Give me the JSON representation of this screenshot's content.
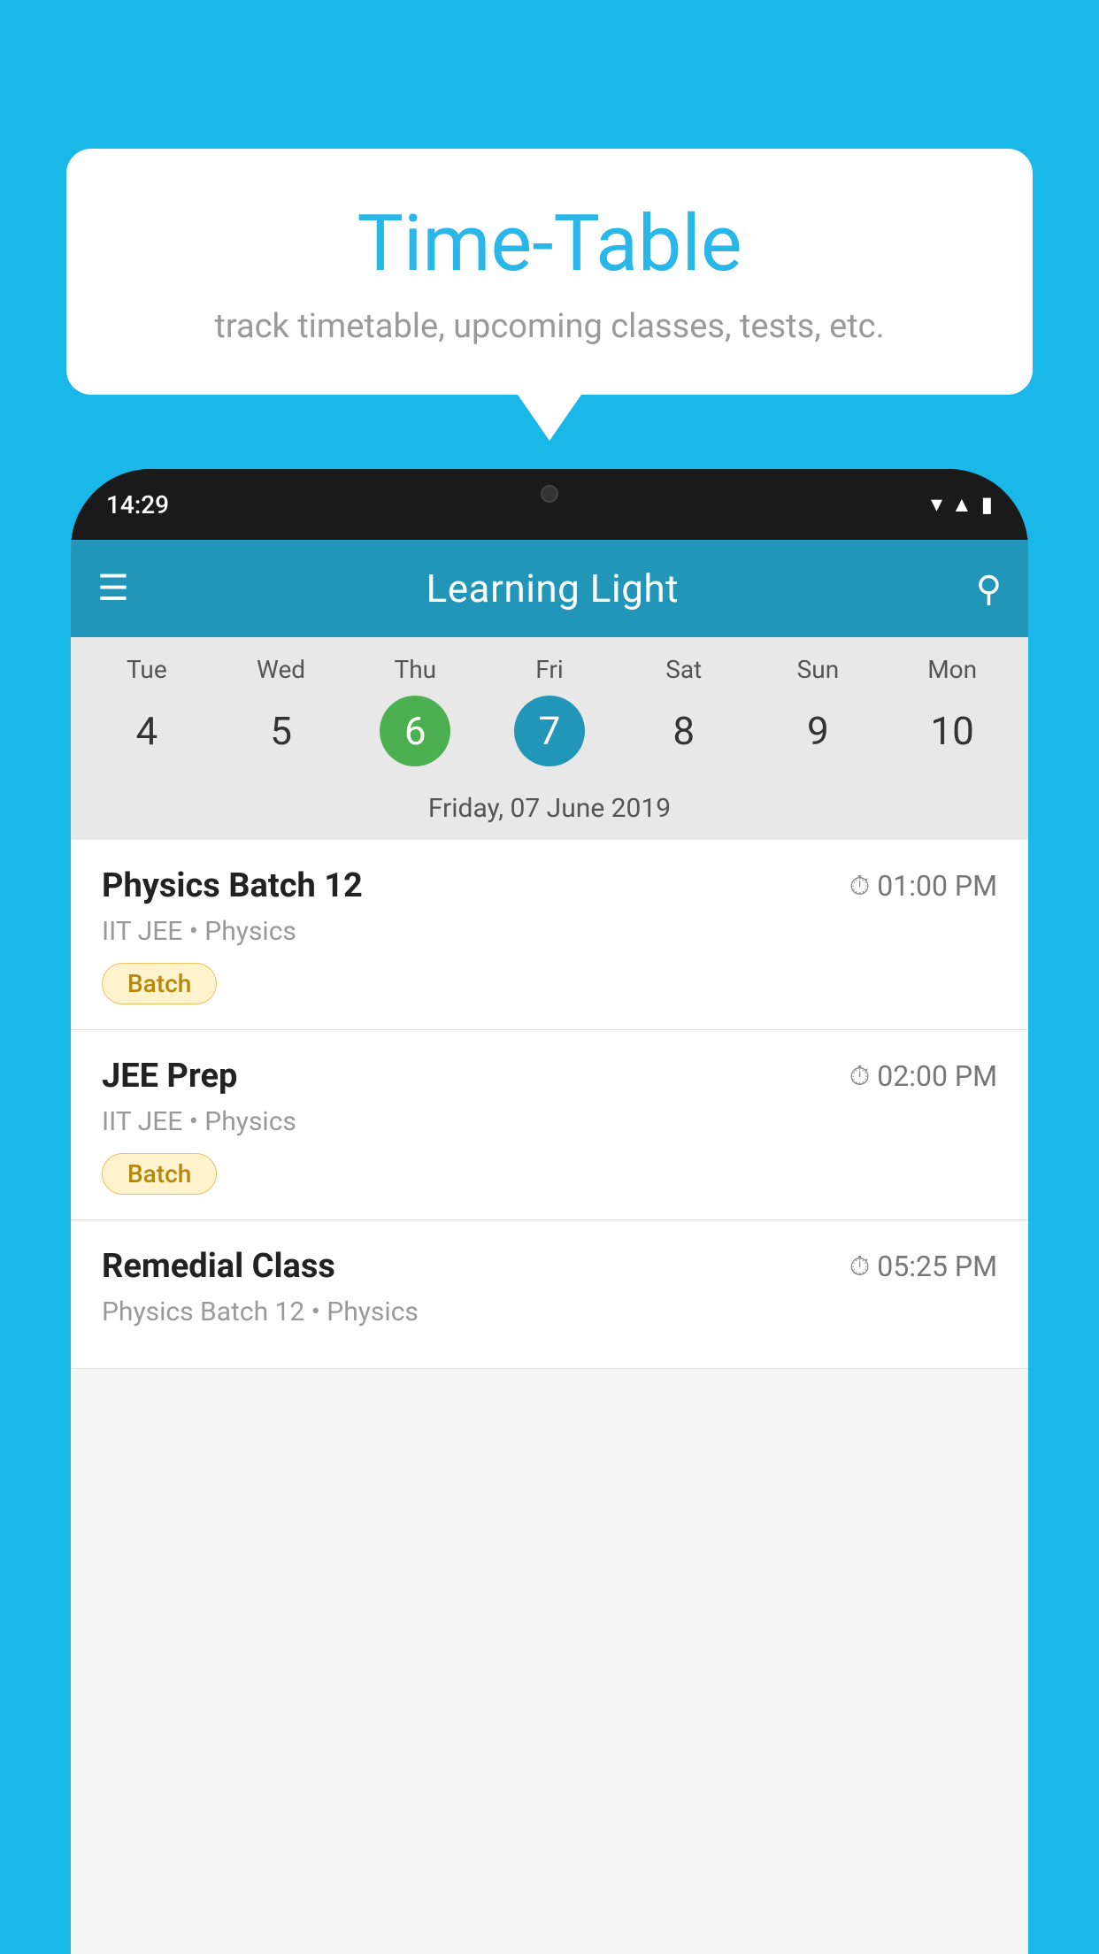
{
  "background_color": "#1ab8e8",
  "bubble": {
    "title": "Time-Table",
    "subtitle": "track timetable, upcoming classes, tests, etc."
  },
  "phone": {
    "status_bar": {
      "time": "14:29"
    },
    "header": {
      "app_name": "Learning Light",
      "menu_icon": "☰",
      "search_icon": "🔍"
    },
    "calendar": {
      "day_names": [
        "Tue",
        "Wed",
        "Thu",
        "Fri",
        "Sat",
        "Sun",
        "Mon"
      ],
      "day_numbers": [
        "4",
        "5",
        "6",
        "7",
        "8",
        "9",
        "10"
      ],
      "today_index": 2,
      "selected_index": 3,
      "selected_date_label": "Friday, 07 June 2019"
    },
    "schedule_items": [
      {
        "title": "Physics Batch 12",
        "time": "01:00 PM",
        "subtitle": "IIT JEE • Physics",
        "badge": "Batch"
      },
      {
        "title": "JEE Prep",
        "time": "02:00 PM",
        "subtitle": "IIT JEE • Physics",
        "badge": "Batch"
      },
      {
        "title": "Remedial Class",
        "time": "05:25 PM",
        "subtitle": "Physics Batch 12 • Physics",
        "badge": null
      }
    ]
  }
}
